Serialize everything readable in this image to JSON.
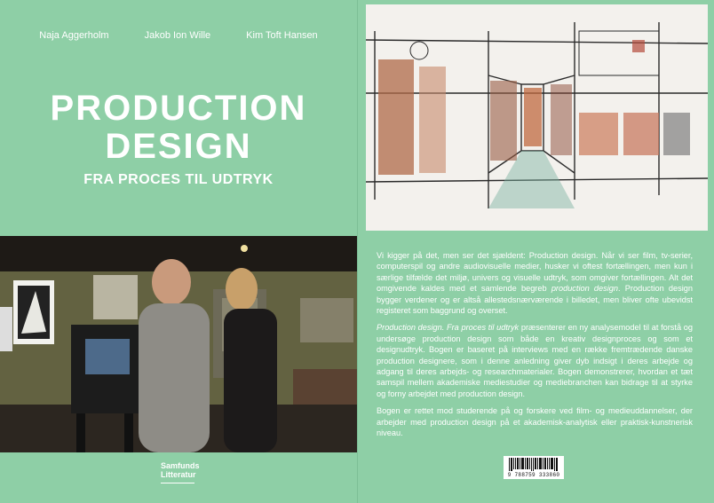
{
  "front": {
    "authors": [
      "Naja Aggerholm",
      "Jakob Ion Wille",
      "Kim Toft Hansen"
    ],
    "title_line1": "PRODUCTION",
    "title_line2": "DESIGN",
    "subtitle": "FRA PROCES TIL UDTRYK",
    "publisher_line1": "Samfunds",
    "publisher_line2": "Litteratur"
  },
  "back": {
    "p1_main": "Vi kigger på det, men ser det sjældent: Production design. Når vi ser film, tv-serier, computerspil og andre audiovisuelle medier, husker vi oftest fortællingen, men kun i særlige tilfælde det miljø, univers og visuelle udtryk, som omgiver fortællingen. Alt det omgivende kaldes med et samlende begreb ",
    "p1_em": "production design",
    "p1_rest": ". Production design bygger verdener og er altså allestedsnærværende i billedet, men bliver ofte ubevidst registeret som baggrund og overset.",
    "p2_em": "Production design. Fra proces til udtryk",
    "p2_rest": " præsenterer en ny analysemodel til at forstå og undersøge production design som både en kreativ designproces og som et designudtryk. Bogen er baseret på interviews med en række fremtrædende danske production designere, som i denne anledning giver dyb indsigt i deres arbejde og adgang til deres arbejds- og researchmaterialer. Bogen demonstrerer, hvordan et tæt samspil mellem akademiske mediestudier og mediebranchen kan bidrage til at styrke og forny arbejdet med production design.",
    "p3": "Bogen er rettet mod studerende på og forskere ved film- og medieuddannelser, der arbejder med production design på et akademisk-analytisk eller praktisk-kunstnerisk niveau.",
    "barcode_number": "9 788759 333860"
  },
  "colors": {
    "cover_green": "#8ecfa6",
    "text": "#ffffff"
  }
}
